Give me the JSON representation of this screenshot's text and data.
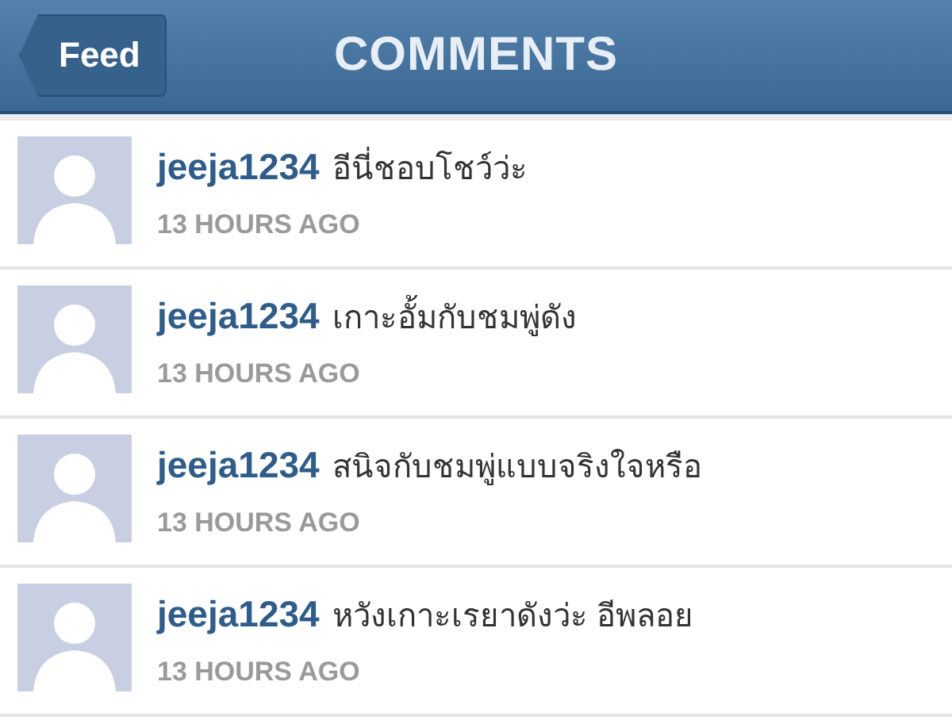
{
  "nav_bar": {
    "back_button": "Feed",
    "title": "COMMENTS"
  },
  "comments": [
    {
      "username": "jeeja1234",
      "text": "อีนี่ชอบโชว์ว่ะ",
      "time": "13 HOURS AGO"
    },
    {
      "username": "jeeja1234",
      "text": "เกาะอั้มกับชมพู่ดัง",
      "time": "13 HOURS AGO"
    },
    {
      "username": "jeeja1234",
      "text": "สนิจกับชมพู่แบบจริงใจหรือ",
      "time": "13 HOURS AGO"
    },
    {
      "username": "jeeja1234",
      "text": "หวังเกาะเรยาดังว่ะ อีพลอย",
      "time": "13 HOURS AGO"
    }
  ]
}
